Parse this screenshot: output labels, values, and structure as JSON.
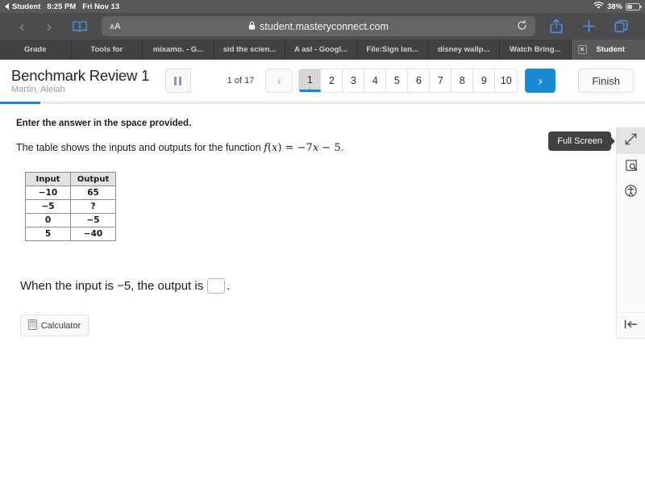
{
  "status_bar": {
    "back_label": "Student",
    "time": "8:25 PM",
    "date": "Fri Nov 13",
    "battery_percent": "38%",
    "wifi_icon": "wifi-icon",
    "battery_icon": "battery-icon"
  },
  "browser": {
    "back_icon": "chevron-left-icon",
    "forward_icon": "chevron-right-icon",
    "bookmarks_icon": "book-icon",
    "text_size_label": "AA",
    "lock_icon": "lock-icon",
    "url": "student.masteryconnect.com",
    "reload_icon": "reload-icon",
    "share_icon": "share-icon",
    "new_tab_icon": "plus-icon",
    "tabs_overview_icon": "tabs-icon"
  },
  "tabs": [
    {
      "label": "Grade",
      "active": false
    },
    {
      "label": "Tools for",
      "active": false
    },
    {
      "label": "mixamo. - G...",
      "active": false
    },
    {
      "label": "sid the scien...",
      "active": false
    },
    {
      "label": "A asl - Googl...",
      "active": false
    },
    {
      "label": "File:Sign lan...",
      "active": false
    },
    {
      "label": "disney wallp...",
      "active": false
    },
    {
      "label": "Watch Bring...",
      "active": false
    },
    {
      "label": "Student",
      "active": true,
      "close_icon": "close-icon"
    }
  ],
  "header": {
    "title": "Benchmark Review 1",
    "student_name": "Martin, Aleiah",
    "pause_icon": "pause-icon",
    "counter": "1 of 17",
    "prev_icon": "chevron-left-icon",
    "next_icon": "chevron-right-icon",
    "page_numbers": [
      "1",
      "2",
      "3",
      "4",
      "5",
      "6",
      "7",
      "8",
      "9",
      "10"
    ],
    "current_page": "1",
    "finish_label": "Finish",
    "progress_percent": 6,
    "accent_color": "#1887cf"
  },
  "question": {
    "instruction": "Enter the answer in the space provided.",
    "stem_prefix": "The table shows the inputs and outputs for the function ",
    "stem_function_f": "f",
    "stem_function_paren_open": "(",
    "stem_function_x": "x",
    "stem_function_paren_close": ")",
    "stem_function_eq": " = ",
    "stem_function_minus7": "−7",
    "stem_function_var": "x",
    "stem_function_tail": " − 5",
    "stem_suffix": ".",
    "table": {
      "headers": [
        "Input",
        "Output"
      ],
      "rows": [
        [
          "−10",
          "65"
        ],
        [
          "−5",
          "?"
        ],
        [
          "0",
          "−5"
        ],
        [
          "5",
          "−40"
        ]
      ]
    },
    "answer_prompt_prefix": "When the input is −5, the output is",
    "answer_value": "",
    "answer_prompt_suffix": ".",
    "calculator_label": "Calculator",
    "calculator_icon": "calculator-icon"
  },
  "tool_rail": {
    "fullscreen_icon": "expand-arrows-icon",
    "magnifier_icon": "magnifier-tool-icon",
    "accessibility_icon": "accessibility-icon",
    "collapse_icon": "collapse-left-icon",
    "tooltip": "Full Screen"
  }
}
